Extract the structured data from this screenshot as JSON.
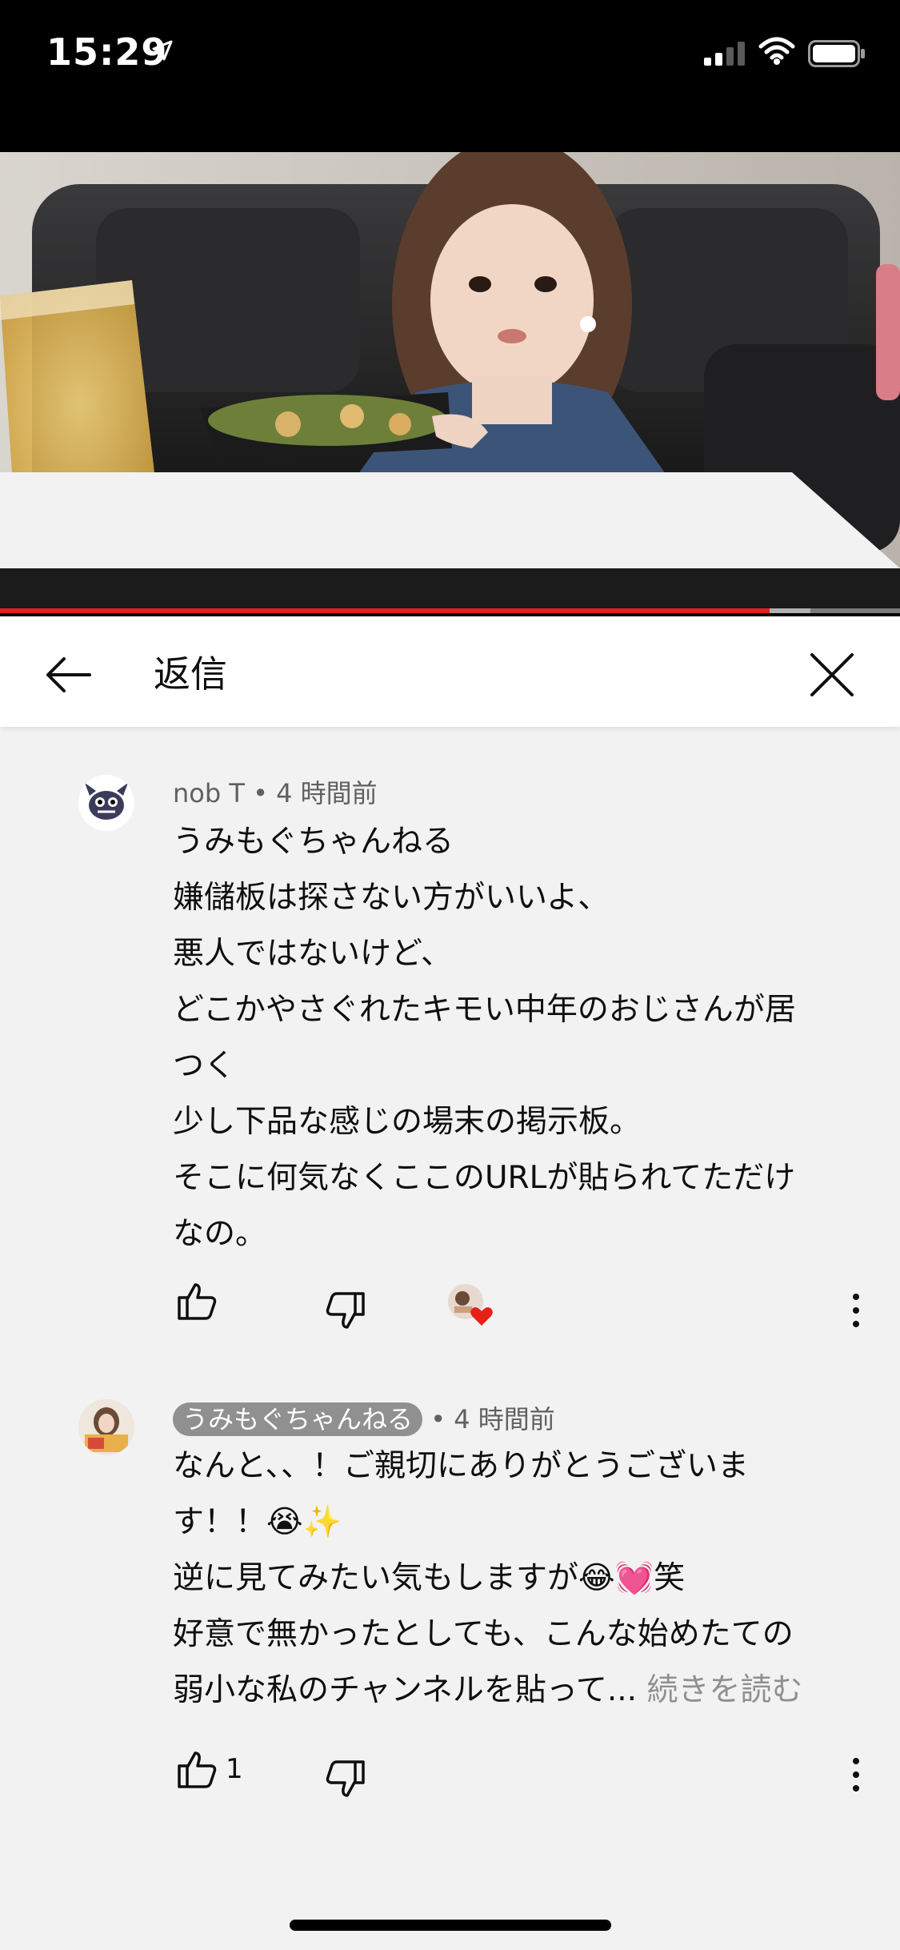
{
  "status_bar": {
    "time": "15:29"
  },
  "video": {
    "progress": 0.855,
    "buffered": 0.9
  },
  "header": {
    "title": "返信"
  },
  "comments": [
    {
      "author": "nob T",
      "time_sep": " • ",
      "time": "4 時間前",
      "lines": [
        "うみもぐちゃんねる",
        "嫌儲板は探さない方がいいよ、",
        "悪人ではないけど、",
        "どこかやさぐれたキモい中年のおじさんが居",
        "つく",
        "少し下品な感じの場末の掲示板。",
        "そこに何気なくここのURLが貼られてただけ",
        "なの。"
      ]
    },
    {
      "author": "うみもぐちゃんねる",
      "time_sep": " • ",
      "time": "4 時間前",
      "lines": [
        "なんと、、！ご親切にありがとうございま",
        "す！！😭✨",
        "逆に見てみたい気もしますが😂💓笑",
        "好意で無かったとしても、こんな始めたての",
        "弱小な私のチャンネルを貼って..."
      ],
      "read_more": "続きを読む",
      "like_count": "1"
    }
  ]
}
